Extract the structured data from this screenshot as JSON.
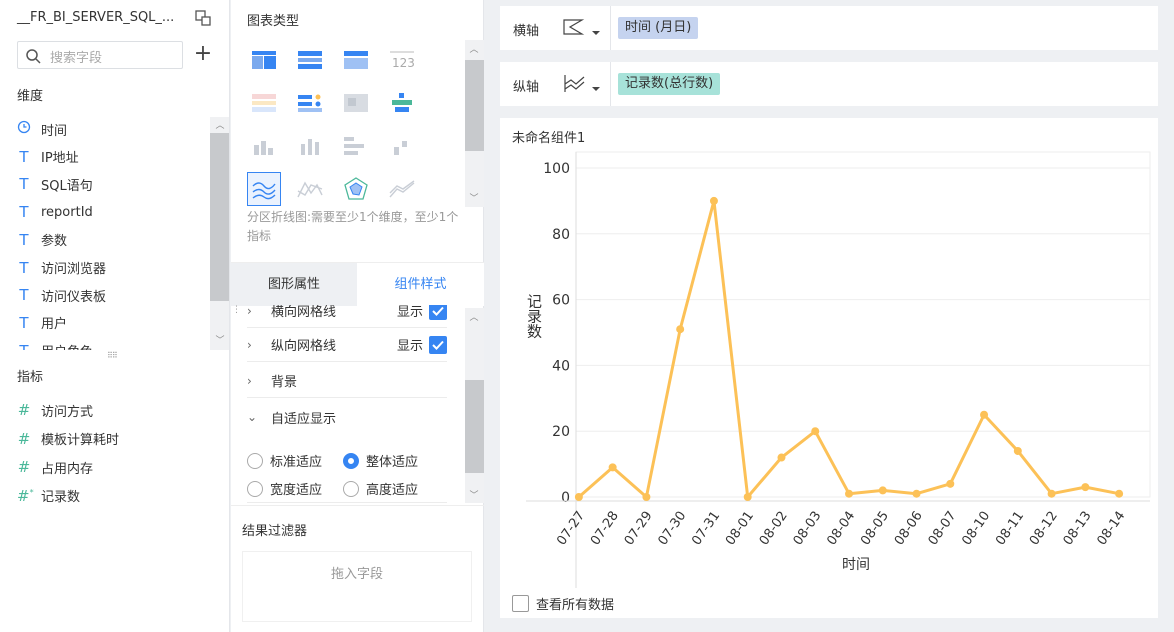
{
  "left": {
    "datasource_title": "__FR_BI_SERVER_SQL_...",
    "search_placeholder": "搜索字段",
    "dimension_header": "维度",
    "dimensions": [
      {
        "icon": "clock-icon",
        "label": "时间"
      },
      {
        "icon": "text-field-icon",
        "label": "IP地址"
      },
      {
        "icon": "text-field-icon",
        "label": "SQL语句"
      },
      {
        "icon": "text-field-icon",
        "label": "reportId"
      },
      {
        "icon": "text-field-icon",
        "label": "参数"
      },
      {
        "icon": "text-field-icon",
        "label": "访问浏览器"
      },
      {
        "icon": "text-field-icon",
        "label": "访问仪表板"
      },
      {
        "icon": "text-field-icon",
        "label": "用户"
      },
      {
        "icon": "text-field-icon",
        "label": "用户角色"
      }
    ],
    "metric_header": "指标",
    "metrics": [
      {
        "icon": "hash-icon",
        "label": "访问方式"
      },
      {
        "icon": "hash-icon",
        "label": "模板计算耗时"
      },
      {
        "icon": "hash-icon",
        "label": "占用内存"
      },
      {
        "icon": "hash-star-icon",
        "label": "记录数"
      }
    ]
  },
  "middle": {
    "chart_type_header": "图表类型",
    "chart_type_hint": "分区折线图:需要至少1个维度，至少1个指标",
    "tabs": [
      "图形属性",
      "组件样式"
    ],
    "active_tab": 1,
    "style_rows": [
      {
        "label": "横向网格线",
        "show_label": "显示",
        "checked": true
      },
      {
        "label": "纵向网格线",
        "show_label": "显示",
        "checked": true
      },
      {
        "label": "背景"
      }
    ],
    "adaptive_label": "自适应显示",
    "adaptive_options": [
      {
        "label": "标准适应",
        "selected": false
      },
      {
        "label": "整体适应",
        "selected": true
      },
      {
        "label": "宽度适应",
        "selected": false
      },
      {
        "label": "高度适应",
        "selected": false
      }
    ],
    "filter_header": "结果过滤器",
    "filter_placeholder": "拖入字段"
  },
  "right": {
    "x_axis_label": "横轴",
    "x_axis_field": "时间 (月日)",
    "y_axis_label": "纵轴",
    "y_axis_field": "记录数(总行数)",
    "component_title": "未命名组件1",
    "view_all_label": "查看所有数据",
    "colors": {
      "pill_x": "#c5d3ef",
      "pill_y": "#a7e2d9",
      "line": "#fcc157",
      "accent": "#3685f2"
    }
  },
  "chart_data": {
    "type": "line",
    "xlabel": "时间",
    "ylabel": "记录数",
    "ylim": [
      0,
      100
    ],
    "yticks": [
      0,
      20,
      40,
      60,
      80,
      100
    ],
    "categories": [
      "07-27",
      "07-28",
      "07-29",
      "07-30",
      "07-31",
      "08-01",
      "08-02",
      "08-03",
      "08-04",
      "08-05",
      "08-06",
      "08-07",
      "08-10",
      "08-11",
      "08-12",
      "08-13",
      "08-14"
    ],
    "values": [
      0,
      9,
      0,
      51,
      90,
      0,
      12,
      20,
      1,
      2,
      1,
      4,
      25,
      14,
      1,
      3,
      1
    ],
    "grid": true
  }
}
